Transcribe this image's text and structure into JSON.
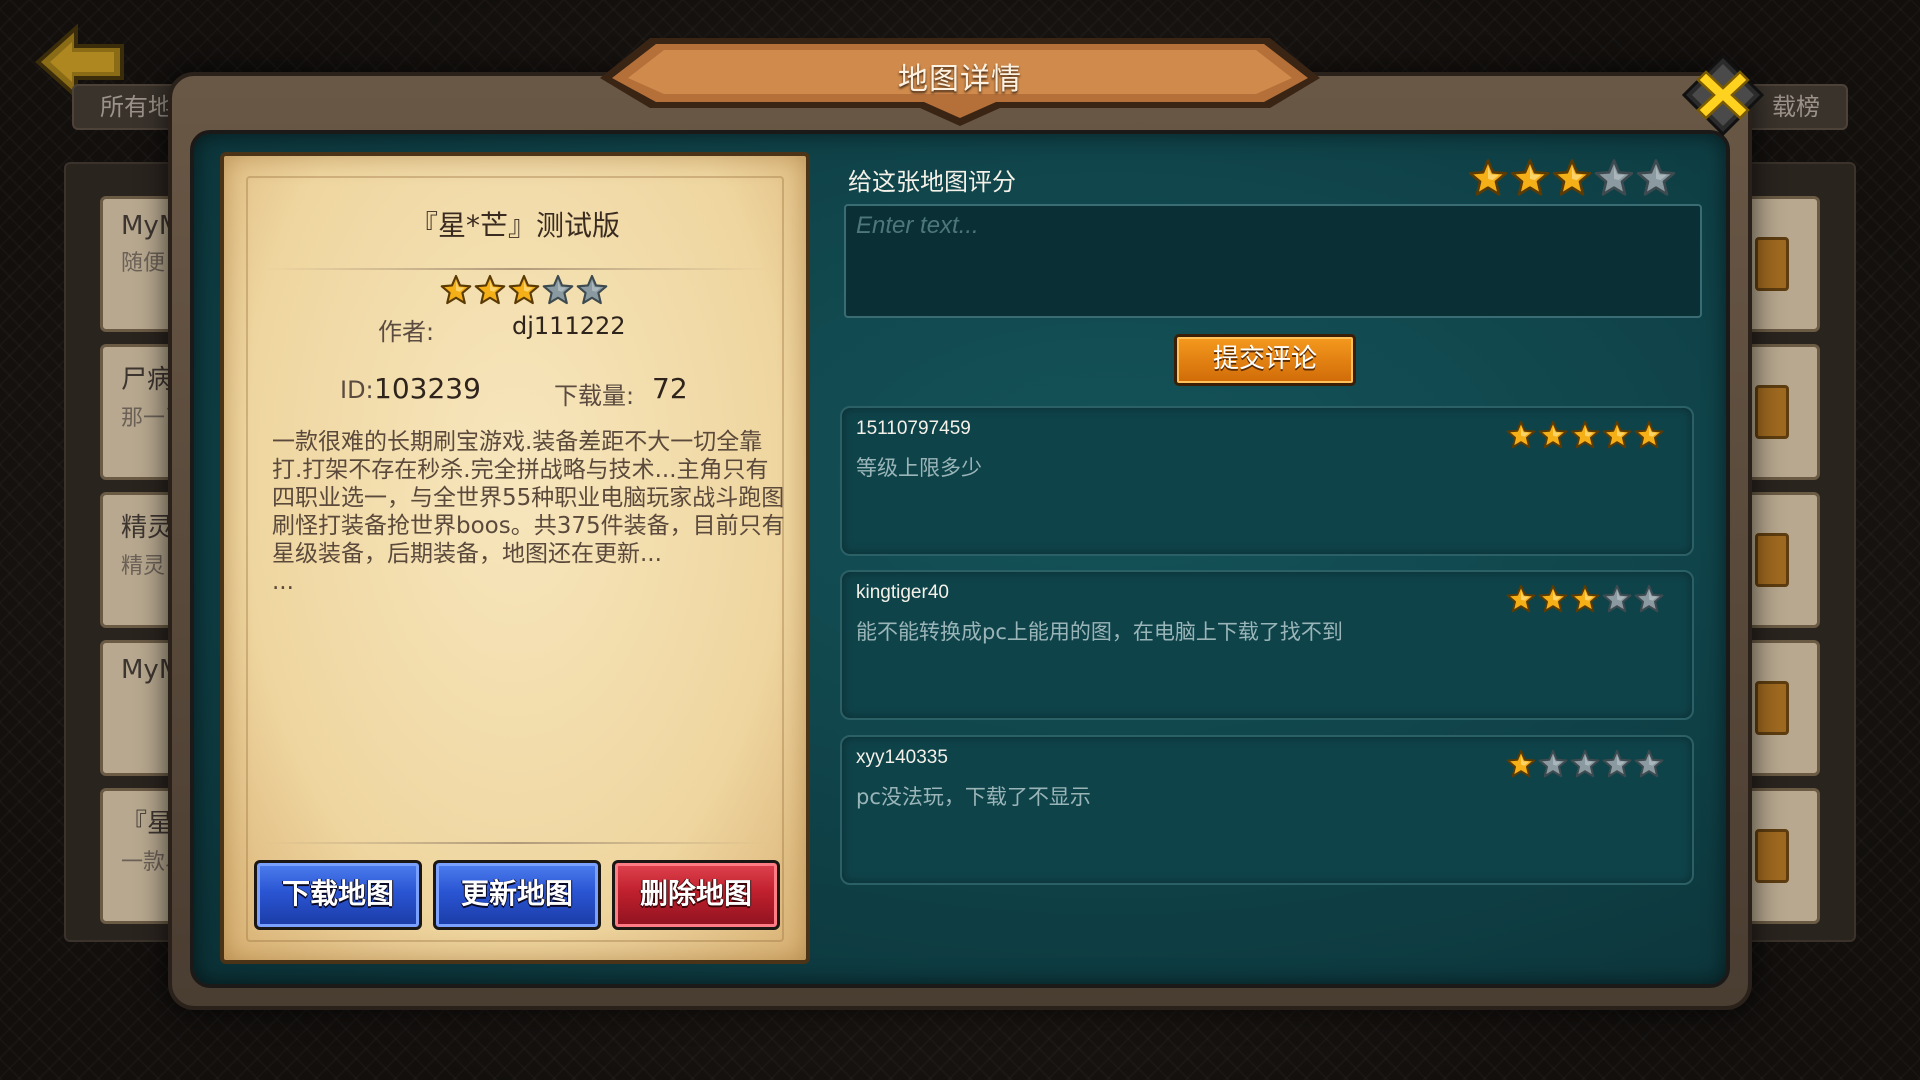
{
  "background": {
    "left_tab_label": "所有地",
    "right_tab_label": "载榜",
    "cards": [
      {
        "title": "MyM",
        "subtitle": "随便"
      },
      {
        "title": "尸病",
        "subtitle": "那一了电"
      },
      {
        "title": "精灵",
        "subtitle": "精灵"
      },
      {
        "title": "MyM",
        "subtitle": ""
      },
      {
        "title": "『星",
        "subtitle": "一款斗跑"
      }
    ]
  },
  "dialog": {
    "title": "地图详情",
    "close_icon": "close-x-icon"
  },
  "map": {
    "name": "『星*芒』测试版",
    "rating": 3,
    "rating_max": 5,
    "author_label": "作者:",
    "author": "dj111222",
    "id_label": "ID:",
    "id": "103239",
    "downloads_label": "下载量:",
    "downloads": "72",
    "description": "一款很难的长期刷宝游戏.装备差距不大一切全靠打.打架不存在秒杀.完全拼战略与技术...主角只有四职业选一，与全世界55种职业电脑玩家战斗跑图刷怪打装备抢世界boos。共375件装备，目前只有星级装备，后期装备，地图还在更新...",
    "description_more": "..."
  },
  "actions": {
    "download": "下载地图",
    "update": "更新地图",
    "delete": "删除地图"
  },
  "review": {
    "label": "给这张地图评分",
    "rating": 3,
    "rating_max": 5,
    "input_value": "",
    "input_placeholder": "Enter text...",
    "submit": "提交评论"
  },
  "comments": [
    {
      "user": "15110797459",
      "text": "等级上限多少",
      "rating": 5
    },
    {
      "user": "kingtiger40",
      "text": "能不能转换成pc上能用的图，在电脑上下载了找不到",
      "rating": 3
    },
    {
      "user": "xyy140335",
      "text": "pc没法玩，下载了不显示",
      "rating": 1
    }
  ],
  "colors": {
    "star_on": "#f5b018",
    "star_off": "#8a9aa0",
    "teal_panel": "#0e3f45",
    "parchment": "#f2dca8",
    "btn_blue": "#2a55d3",
    "btn_red": "#c0202d",
    "btn_orange": "#e07d10"
  }
}
